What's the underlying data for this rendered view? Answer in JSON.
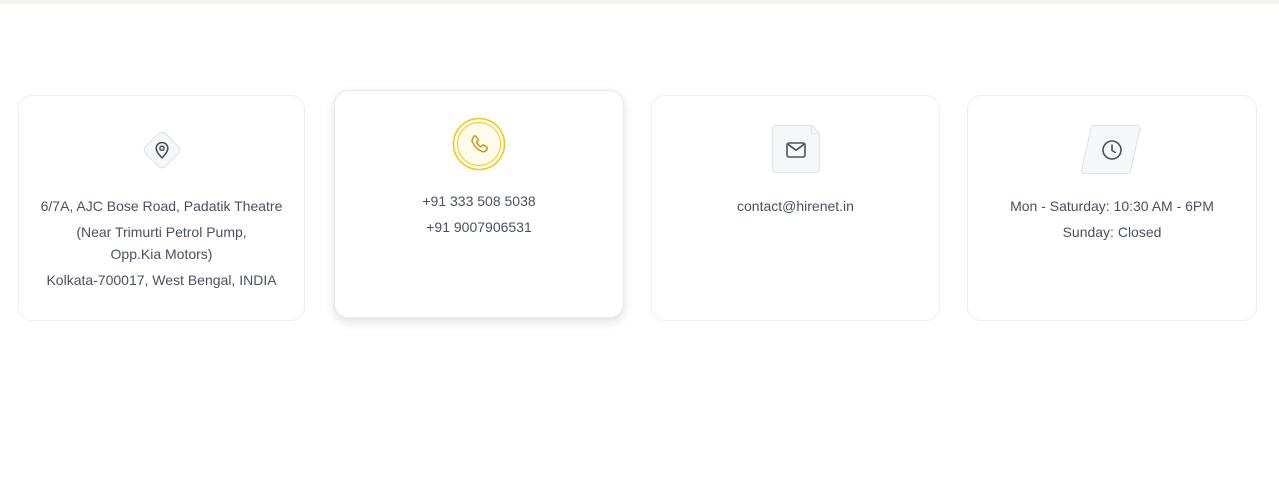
{
  "colors": {
    "accent": "#f2c81b",
    "accent_dark": "#c79a13",
    "icon_stroke": "#4a5060",
    "card_border": "#eceef2",
    "text": "#4a5060",
    "top_band": "#f6f3ec"
  },
  "cards": [
    {
      "icon": "location-pin-icon",
      "lines": [
        "6/7A, AJC Bose Road, Padatik Theatre",
        "(Near Trimurti Petrol Pump, Opp.Kia Motors)",
        "Kolkata-700017, West Bengal, INDIA"
      ]
    },
    {
      "icon": "phone-icon",
      "lines": [
        "+91 333 508 5038",
        "+91 9007906531"
      ]
    },
    {
      "icon": "mail-icon",
      "lines": [
        "contact@hirenet.in"
      ]
    },
    {
      "icon": "clock-icon",
      "lines": [
        "Mon - Saturday: 10:30 AM - 6PM",
        "Sunday: Closed"
      ]
    }
  ]
}
